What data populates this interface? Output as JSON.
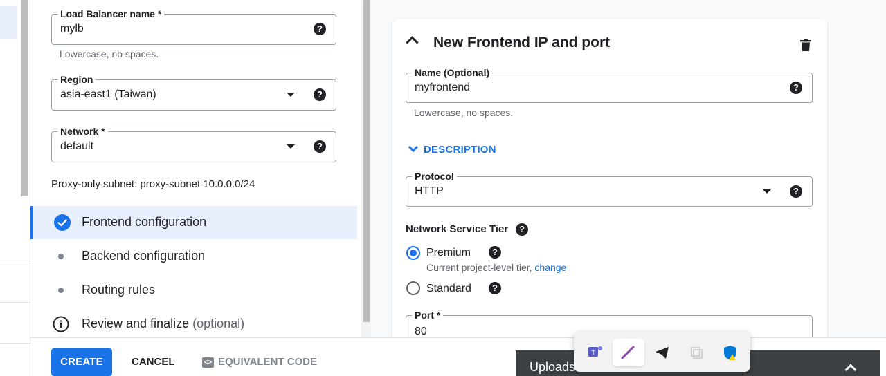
{
  "left_form": {
    "lb_name": {
      "label": "Load Balancer name *",
      "value": "mylb",
      "hint": "Lowercase, no spaces."
    },
    "region": {
      "label": "Region",
      "value": "asia-east1 (Taiwan)"
    },
    "network": {
      "label": "Network *",
      "value": "default"
    },
    "proxy_subnet": "Proxy-only subnet: proxy-subnet 10.0.0.0/24"
  },
  "steps": [
    {
      "label": "Frontend configuration",
      "state": "done"
    },
    {
      "label": "Backend configuration",
      "state": "pending"
    },
    {
      "label": "Routing rules",
      "state": "pending"
    },
    {
      "label": "Review and finalize",
      "optional": "(optional)",
      "state": "info"
    }
  ],
  "actions": {
    "create": "CREATE",
    "cancel": "CANCEL",
    "equivalent_code": "EQUIVALENT CODE"
  },
  "frontend_card": {
    "title": "New Frontend IP and port",
    "name": {
      "label": "Name (Optional)",
      "value": "myfrontend",
      "hint": "Lowercase, no spaces."
    },
    "description_toggle": "DESCRIPTION",
    "protocol": {
      "label": "Protocol",
      "value": "HTTP"
    },
    "network_tier": {
      "label": "Network Service Tier",
      "options": [
        {
          "label": "Premium",
          "selected": true,
          "note": "Current project-level tier, ",
          "note_link": "change"
        },
        {
          "label": "Standard",
          "selected": false
        }
      ]
    },
    "port": {
      "label": "Port *",
      "value": "80"
    }
  },
  "upload_bar": {
    "text": "Uploads"
  },
  "icons": {
    "help": "help-icon",
    "caret": "dropdown-caret-icon",
    "trash": "trash-icon",
    "check": "check-circle-icon",
    "info": "info-icon"
  },
  "colors": {
    "accent": "#1a73e8",
    "active_step_bg": "#e8f0fe"
  }
}
